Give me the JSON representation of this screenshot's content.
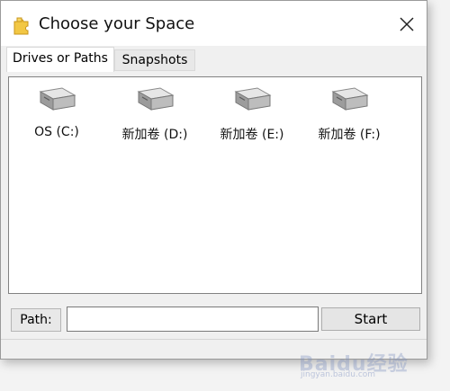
{
  "window": {
    "title": "Choose your Space"
  },
  "tabs": [
    {
      "label": "Drives or Paths",
      "active": true
    },
    {
      "label": "Snapshots",
      "active": false
    }
  ],
  "drives": [
    {
      "label": "OS (C:)",
      "icon": "hard-drive-icon"
    },
    {
      "label": "新加卷 (D:)",
      "icon": "hard-drive-icon"
    },
    {
      "label": "新加卷 (E:)",
      "icon": "hard-drive-icon"
    },
    {
      "label": "新加卷 (F:)",
      "icon": "hard-drive-icon"
    }
  ],
  "path": {
    "label": "Path:",
    "value": "",
    "placeholder": ""
  },
  "start_button": {
    "label": "Start"
  },
  "watermark": {
    "text": "Baidu经验",
    "sub": "jingyan.baidu.com"
  },
  "colors": {
    "title_bg": "#ffffff",
    "window_bg": "#f0f0f0",
    "pane_bg": "#ffffff",
    "button_bg": "#e5e5e5",
    "app_icon": "#f2c744"
  }
}
